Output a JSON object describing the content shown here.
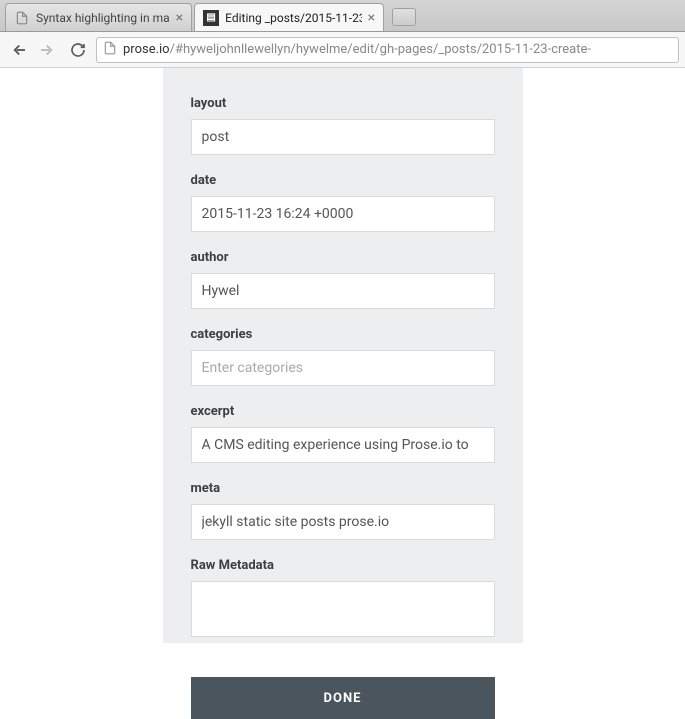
{
  "browser": {
    "tabs": [
      {
        "title": "Syntax highlighting in ma",
        "active": false
      },
      {
        "title": "Editing _posts/2015-11-23",
        "active": true
      }
    ],
    "url_host": "prose.io",
    "url_path": "/#hyweljohnllewellyn/hywelme/edit/gh-pages/_posts/2015-11-23-create-"
  },
  "form": {
    "layout": {
      "label": "layout",
      "value": "post"
    },
    "date": {
      "label": "date",
      "value": "2015-11-23 16:24 +0000"
    },
    "author": {
      "label": "author",
      "value": "Hywel"
    },
    "categories": {
      "label": "categories",
      "value": "",
      "placeholder": "Enter categories"
    },
    "excerpt": {
      "label": "excerpt",
      "value": "A CMS editing experience using Prose.io to"
    },
    "meta": {
      "label": "meta",
      "value": "jekyll static site posts prose.io"
    },
    "rawmeta": {
      "label": "Raw Metadata",
      "value": ""
    }
  },
  "buttons": {
    "done": "DONE"
  }
}
